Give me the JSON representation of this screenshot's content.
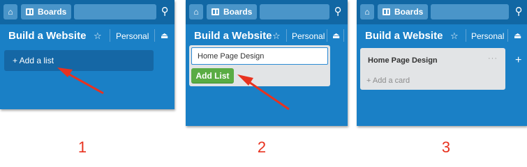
{
  "panels": [
    {
      "home_icon": "home-icon",
      "boards_label": "Boards",
      "board_title": "Build a Website",
      "star_icon": "star-icon",
      "visibility_label": "Personal",
      "lock_icon": "lock-icon",
      "add_list_label": "+ Add a list",
      "step_label": "1"
    },
    {
      "boards_label": "Boards",
      "board_title": "Build a Website",
      "visibility_label": "Personal",
      "list_input_value": "Home Page Design",
      "add_list_button": "Add List",
      "step_label": "2"
    },
    {
      "boards_label": "Boards",
      "board_title": "Build a Website",
      "visibility_label": "Personal",
      "list_name": "Home Page Design",
      "list_menu": "···",
      "add_card_label": "+ Add a card",
      "step_label": "3"
    }
  ],
  "colors": {
    "board_bg": "#1a80c6",
    "topbar_bg": "#1167a4",
    "button_green": "#5aac44",
    "annotation_red": "#e8321f"
  }
}
